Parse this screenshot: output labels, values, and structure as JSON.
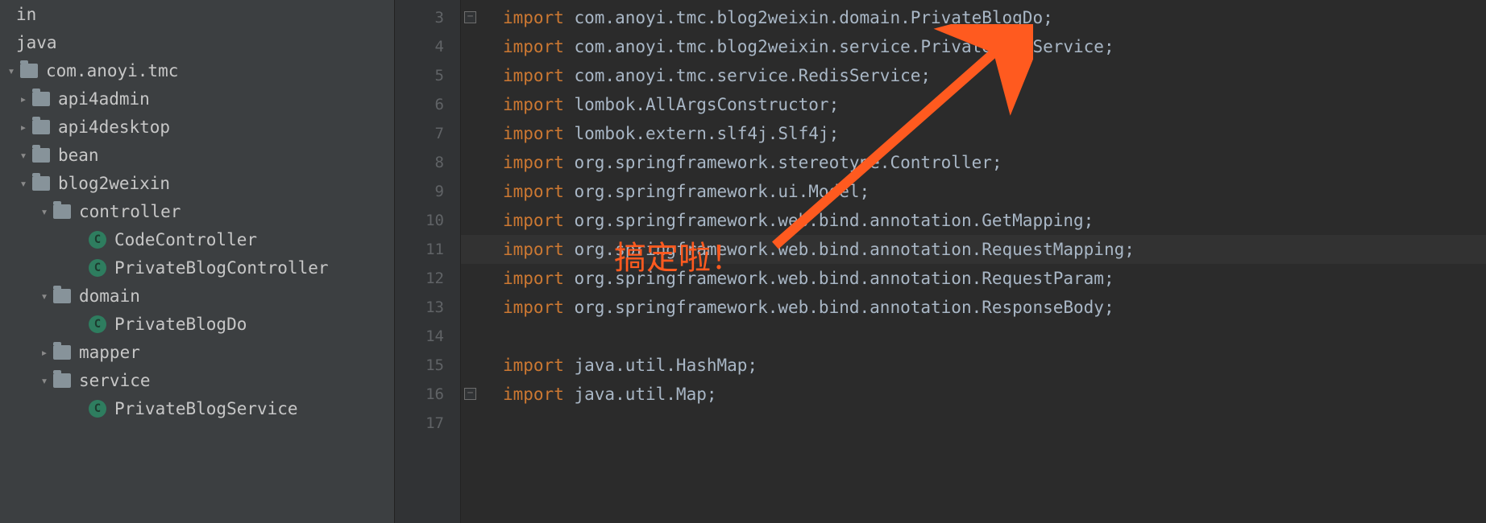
{
  "sidebar": {
    "rows": [
      {
        "indent": 0,
        "arrow": "",
        "icon": "",
        "label": "in"
      },
      {
        "indent": 0,
        "arrow": "",
        "icon": "",
        "label": "java"
      },
      {
        "indent": 5,
        "arrow": "down",
        "icon": "folder",
        "label": "com.anoyi.tmc"
      },
      {
        "indent": 20,
        "arrow": "right",
        "icon": "folder",
        "label": "api4admin"
      },
      {
        "indent": 20,
        "arrow": "right",
        "icon": "folder",
        "label": "api4desktop"
      },
      {
        "indent": 20,
        "arrow": "down",
        "icon": "folder",
        "label": "bean"
      },
      {
        "indent": 20,
        "arrow": "down",
        "icon": "folder",
        "label": "blog2weixin"
      },
      {
        "indent": 46,
        "arrow": "down",
        "icon": "folder",
        "label": "controller"
      },
      {
        "indent": 90,
        "arrow": "",
        "icon": "class",
        "label": "CodeController"
      },
      {
        "indent": 90,
        "arrow": "",
        "icon": "class",
        "label": "PrivateBlogController"
      },
      {
        "indent": 46,
        "arrow": "down",
        "icon": "folder",
        "label": "domain"
      },
      {
        "indent": 90,
        "arrow": "",
        "icon": "class",
        "label": "PrivateBlogDo"
      },
      {
        "indent": 46,
        "arrow": "right",
        "icon": "folder",
        "label": "mapper"
      },
      {
        "indent": 46,
        "arrow": "down",
        "icon": "folder",
        "label": "service"
      },
      {
        "indent": 90,
        "arrow": "",
        "icon": "class",
        "label": "PrivateBlogService"
      }
    ]
  },
  "editor": {
    "lines": [
      {
        "num": 3,
        "fold": "minus-top",
        "kw": "import",
        "rest": " com.anoyi.tmc.blog2weixin.domain.PrivateBlogDo;"
      },
      {
        "num": 4,
        "kw": "import",
        "rest": " com.anoyi.tmc.blog2weixin.service.PrivateBlogService;"
      },
      {
        "num": 5,
        "kw": "import",
        "rest": " com.anoyi.tmc.service.RedisService;"
      },
      {
        "num": 6,
        "kw": "import",
        "rest": " lombok.AllArgsConstructor;"
      },
      {
        "num": 7,
        "kw": "import",
        "rest": " lombok.extern.slf4j.Slf4j;"
      },
      {
        "num": 8,
        "kw": "import",
        "rest": " org.springframework.stereotype.Controller;"
      },
      {
        "num": 9,
        "kw": "import",
        "rest": " org.springframework.ui.Model;"
      },
      {
        "num": 10,
        "kw": "import",
        "rest": " org.springframework.web.bind.annotation.GetMapping;"
      },
      {
        "num": 11,
        "highlight": true,
        "kw": "import",
        "rest": " org.springframework.web.bind.annotation.RequestMapping;"
      },
      {
        "num": 12,
        "kw": "import",
        "rest": " org.springframework.web.bind.annotation.RequestParam;"
      },
      {
        "num": 13,
        "kw": "import",
        "rest": " org.springframework.web.bind.annotation.ResponseBody;"
      },
      {
        "num": 14,
        "kw": "",
        "rest": ""
      },
      {
        "num": 15,
        "kw": "import",
        "rest": " java.util.HashMap;"
      },
      {
        "num": 16,
        "fold": "minus-bot",
        "kw": "import",
        "rest": " java.util.Map;"
      },
      {
        "num": 17,
        "kw": "",
        "rest": ""
      }
    ]
  },
  "annotation": {
    "text": "搞定啦！"
  }
}
